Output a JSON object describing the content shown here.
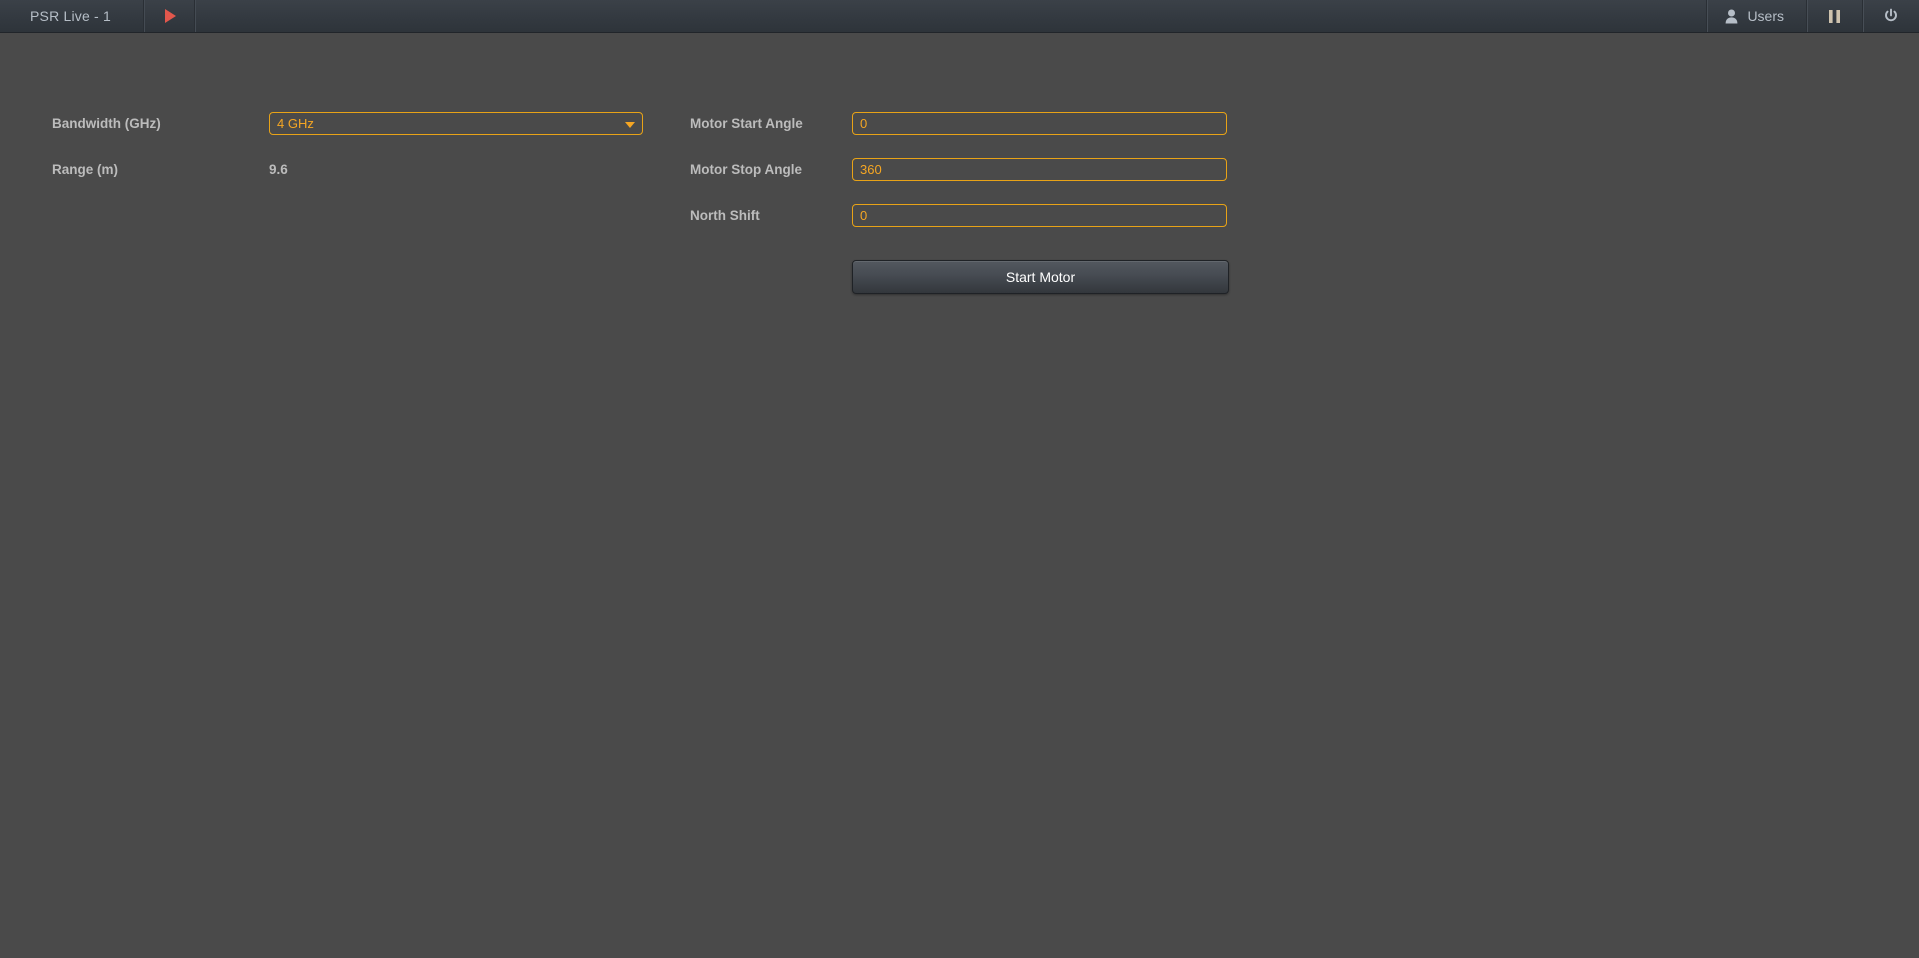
{
  "topbar": {
    "title": "PSR Live - 1",
    "play_icon": "play-icon",
    "users_label": "Users",
    "users_icon": "user-icon",
    "pause_icon": "pause-icon",
    "power_icon": "power-icon"
  },
  "form": {
    "left": {
      "bandwidth": {
        "label": "Bandwidth (GHz)",
        "value": "4 GHz",
        "caret_icon": "chevron-down-icon"
      },
      "range": {
        "label": "Range (m)",
        "value": "9.6"
      }
    },
    "right": {
      "motor_start_angle": {
        "label": "Motor Start Angle",
        "value": "0",
        "placeholder": "0"
      },
      "motor_stop_angle": {
        "label": "Motor Stop Angle",
        "value": "360",
        "placeholder": "360"
      },
      "north_shift": {
        "label": "North Shift",
        "value": "0",
        "placeholder": "0"
      },
      "start_motor_button": "Start Motor"
    }
  },
  "colors": {
    "accent": "#f5a623",
    "background": "#4a4a4a",
    "topbar": "#343a41",
    "play": "#e2574c",
    "text": "#bcbcbc"
  }
}
